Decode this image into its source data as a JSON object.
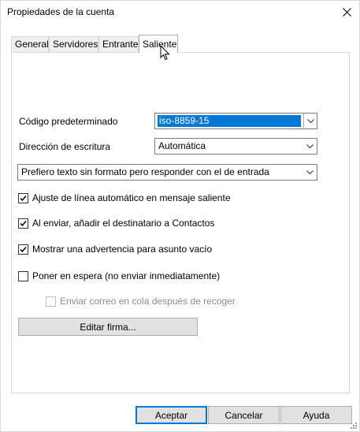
{
  "window": {
    "title": "Propiedades de la cuenta"
  },
  "tabs": [
    {
      "label": "General"
    },
    {
      "label": "Servidores"
    },
    {
      "label": "Entrante"
    },
    {
      "label": "Saliente"
    }
  ],
  "selected_tab": "Saliente",
  "form": {
    "encoding_label": "Código predeterminado",
    "encoding_value": "iso-8859-15",
    "direction_label": "Dirección de escritura",
    "direction_value": "Automática",
    "format_value": "Prefiero texto sin formato pero responder con el de entrada"
  },
  "checkboxes": [
    {
      "label": "Ajuste de línea automático en mensaje saliente",
      "checked": true,
      "enabled": true
    },
    {
      "label": "Al enviar, añadir el destinatario a Contactos",
      "checked": true,
      "enabled": true
    },
    {
      "label": "Mostrar una advertencia para asunto vacío",
      "checked": true,
      "enabled": true
    },
    {
      "label": "Poner en espera (no enviar inmediatamente)",
      "checked": false,
      "enabled": true
    },
    {
      "label": "Enviar correo en cola después de recoger",
      "checked": false,
      "enabled": false
    }
  ],
  "buttons": {
    "edit_signature": "Editar firma...",
    "accept": "Aceptar",
    "cancel": "Cancelar",
    "help": "Ayuda"
  },
  "colors": {
    "accent": "#0078d7",
    "button_face": "#e1e1e1",
    "border": "#adadad"
  }
}
